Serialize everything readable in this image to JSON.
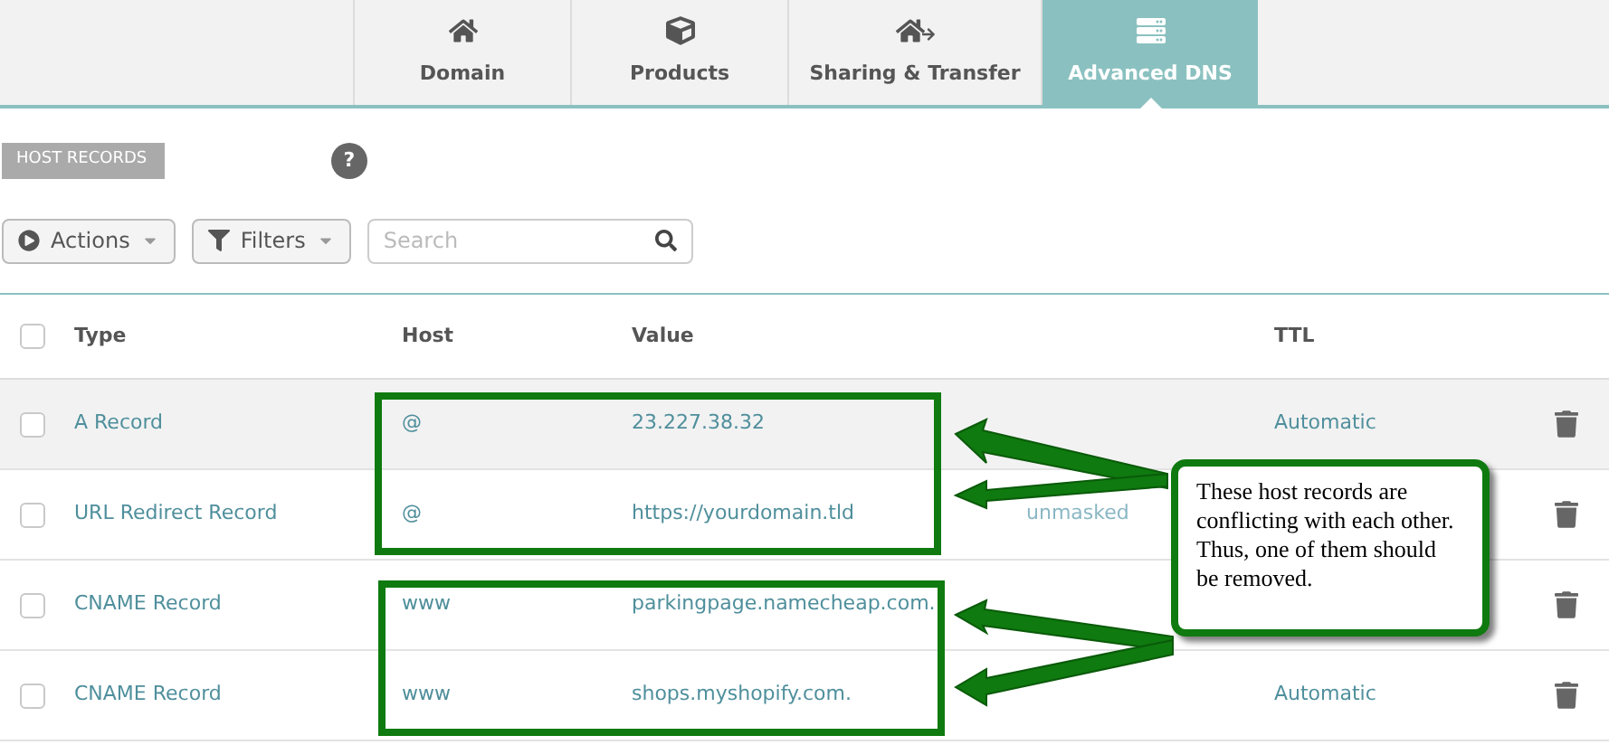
{
  "tabs": [
    {
      "label": "Domain",
      "kind": "home",
      "selected": false
    },
    {
      "label": "Products",
      "kind": "box",
      "selected": false
    },
    {
      "label": "Sharing & Transfer",
      "kind": "transfer",
      "selected": false
    },
    {
      "label": "Advanced DNS",
      "kind": "dns",
      "selected": true
    }
  ],
  "section": {
    "label": "HOST RECORDS",
    "help": "?"
  },
  "toolbar": {
    "actions": "Actions",
    "filters": "Filters",
    "search": {
      "placeholder": "Search"
    }
  },
  "table": {
    "header_checked": false,
    "columns": [
      "Type",
      "Host",
      "Value",
      "TTL"
    ],
    "rows": [
      {
        "type": "A Record",
        "host": "@",
        "value": "23.227.38.32",
        "ttl": "Automatic",
        "checked": false,
        "highlighted": true
      },
      {
        "type": "URL Redirect Record",
        "host": "@",
        "value": "https://yourdomain.tld",
        "extra": "unmasked",
        "checked": false,
        "highlighted": false
      },
      {
        "type": "CNAME Record",
        "host": "www",
        "value": "parkingpage.namecheap.com.",
        "checked": false,
        "highlighted": false
      },
      {
        "type": "CNAME Record",
        "host": "www",
        "value": "shops.myshopify.com.",
        "ttl": "Automatic",
        "checked": false,
        "highlighted": false
      }
    ]
  },
  "annotation": {
    "note": "These host records are conflicting with each other. Thus, one of them should be removed."
  }
}
